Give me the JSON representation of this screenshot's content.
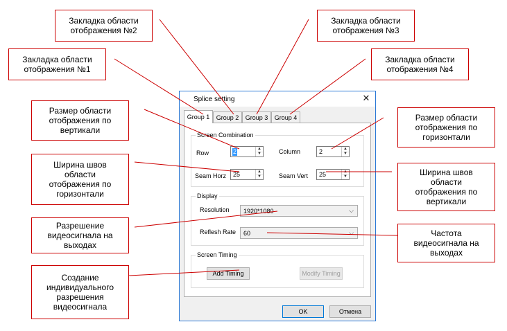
{
  "dialog": {
    "title": "Splice setting",
    "close_icon": "close-icon",
    "tabs": [
      "Group 1",
      "Group 2",
      "Group 3",
      "Group 4"
    ],
    "active_tab": "Group 1",
    "screen_combination": {
      "legend": "Screen Combination",
      "row_label": "Row",
      "row_value": "2",
      "column_label": "Column",
      "column_value": "2",
      "seam_horz_label": "Seam Horz",
      "seam_horz_value": "25",
      "seam_vert_label": "Seam Vert",
      "seam_vert_value": "25"
    },
    "display": {
      "legend": "Display",
      "resolution_label": "Resolution",
      "resolution_value": "1920*1080",
      "refresh_label": "Reflesh Rate",
      "refresh_value": "60"
    },
    "screen_timing": {
      "legend": "Screen Timing",
      "add_button": "Add Timing",
      "modify_button": "Modify Timing"
    },
    "ok_button": "OK",
    "cancel_button": "Отмена"
  },
  "callouts": {
    "tab2": "Закладка области\nотображения №2",
    "tab3": "Закладка области\nотображения №3",
    "tab1": "Закладка области\nотображения №1",
    "tab4": "Закладка области\nотображения №4",
    "vertical_size": "Размер области\nотображения по\nвертикали",
    "horizontal_size": "Размер области\nотображения по\nгоризонтали",
    "seam_horizontal": "Ширина швов\nобласти\nотображения по\nгоризонтали",
    "seam_vertical": "Ширина швов\nобласти\nотображения по\nвертикали",
    "resolution": "Разрешение\nвидеосигнала на\nвыходах",
    "frequency": "Частота\nвидеосигнала на\nвыходах",
    "custom_resolution": "Создание\nиндивидуального\nразрешения\nвидеосигнала"
  },
  "colors": {
    "callout_border": "#cc0000",
    "dialog_border": "#2b79d6"
  }
}
